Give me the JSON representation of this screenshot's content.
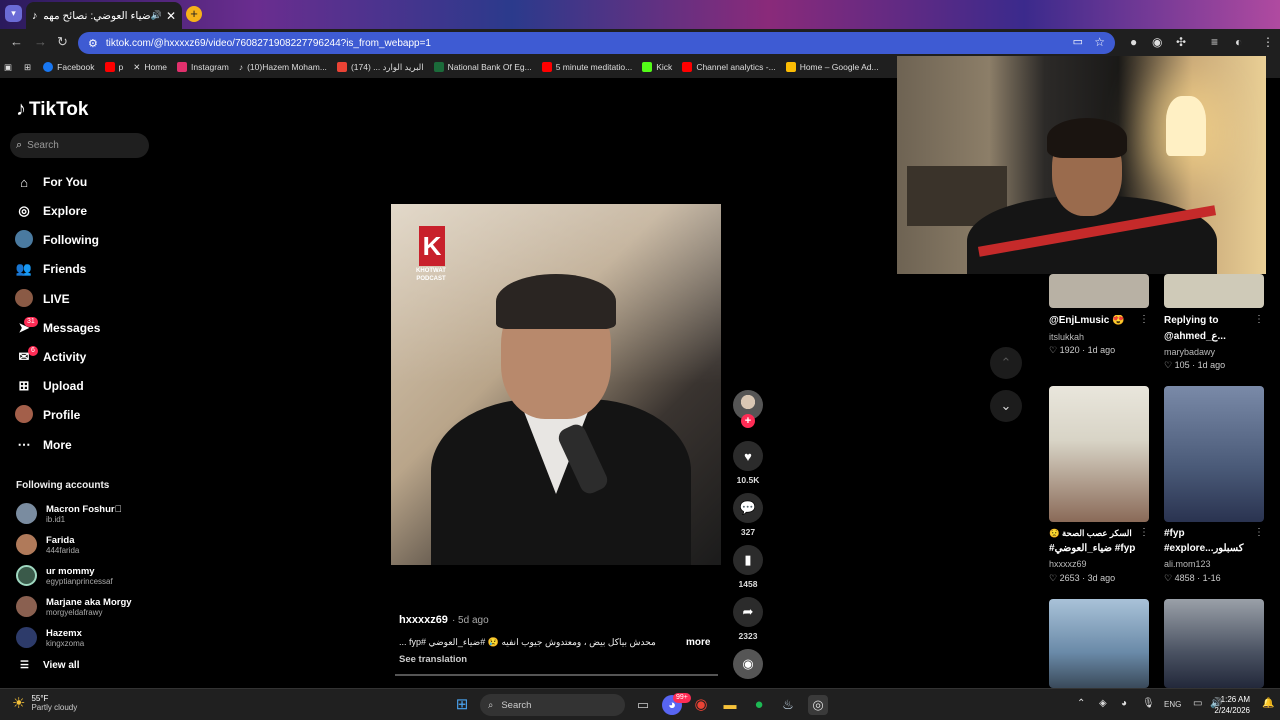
{
  "browser": {
    "tab_title": "ضياء العوضي: نصائح مهمة ...",
    "url": "tiktok.com/@hxxxxz69/video/7608271908227796244?is_from_webapp=1",
    "bookmarks": [
      {
        "label": "Facebook",
        "color": "#1877f2"
      },
      {
        "label": "p",
        "color": "#ff0000"
      },
      {
        "label": "Home",
        "color": "#222222"
      },
      {
        "label": "Instagram",
        "color": "#e1306c"
      },
      {
        "label": "(10)Hazem Moham...",
        "color": "#111111"
      },
      {
        "label": "(174) ... البريد الوارد",
        "color": "#ea4335"
      },
      {
        "label": "National Bank Of Eg...",
        "color": "#1b6b3a"
      },
      {
        "label": "5 minute meditatio...",
        "color": "#ff0000"
      },
      {
        "label": "Kick",
        "color": "#53fc18"
      },
      {
        "label": "Channel analytics -...",
        "color": "#ff0000"
      },
      {
        "label": "Home – Google Ad...",
        "color": "#fbbc04"
      }
    ]
  },
  "tiktok": {
    "logo": "TikTok",
    "search_placeholder": "Search",
    "nav": [
      {
        "label": "For You"
      },
      {
        "label": "Explore"
      },
      {
        "label": "Following"
      },
      {
        "label": "Friends"
      },
      {
        "label": "LIVE"
      },
      {
        "label": "Messages",
        "badge": "31"
      },
      {
        "label": "Activity",
        "badge": "6"
      },
      {
        "label": "Upload"
      },
      {
        "label": "Profile"
      },
      {
        "label": "More"
      }
    ],
    "following_title": "Following accounts",
    "following": [
      {
        "name": "Macron Foshur🏽",
        "handle": "ib.id1"
      },
      {
        "name": "Farida",
        "handle": "444farida"
      },
      {
        "name": "ur mommy",
        "handle": "egyptianprincessaf"
      },
      {
        "name": "Marjane aka Morgy",
        "handle": "morgyeldafrawy"
      },
      {
        "name": "Hazemx",
        "handle": "kingxzoma"
      }
    ],
    "view_all": "View all"
  },
  "video": {
    "podcast_line1": "KHOTWAT",
    "podcast_line2": "PODCAST",
    "author": "hxxxxz69",
    "time": "· 5d ago",
    "caption": "محدش بياكل بيض ، ومعتدوش جيوب انفيه 😢 #ضياء_العوضي #fyp ...",
    "more": "more",
    "see_translation": "See translation",
    "likes": "10.5K",
    "comments": "327",
    "saves": "1458",
    "shares": "2323"
  },
  "suggestions": [
    {
      "title": "@EnjLmusic 😍",
      "user": "itslukkah",
      "likes": "1920",
      "time": "1d ago",
      "color": "#b8b1a4"
    },
    {
      "title": "Replying to",
      "title2": "@ahmed_ع...",
      "user": "marybadawy",
      "likes": "105",
      "time": "1d ago",
      "color": "#cfcab8"
    },
    {
      "title": "السكر عصب الصحة 😟",
      "title2": "#ضياء_العوضي #fyp",
      "user": "hxxxxz69",
      "likes": "2653",
      "time": "3d ago",
      "color": "#d8d4c6"
    },
    {
      "title": "#fyp",
      "title2": "#explore...كسبلور",
      "user": "ali.mom123",
      "likes": "4858",
      "time": "1-16",
      "color": "#5c6f8c"
    }
  ],
  "taskbar": {
    "temp": "55°F",
    "condition": "Partly cloudy",
    "search": "Search",
    "lang": "ENG",
    "time": "1:26 AM",
    "date": "2/24/2026",
    "discord_badge": "99+"
  }
}
